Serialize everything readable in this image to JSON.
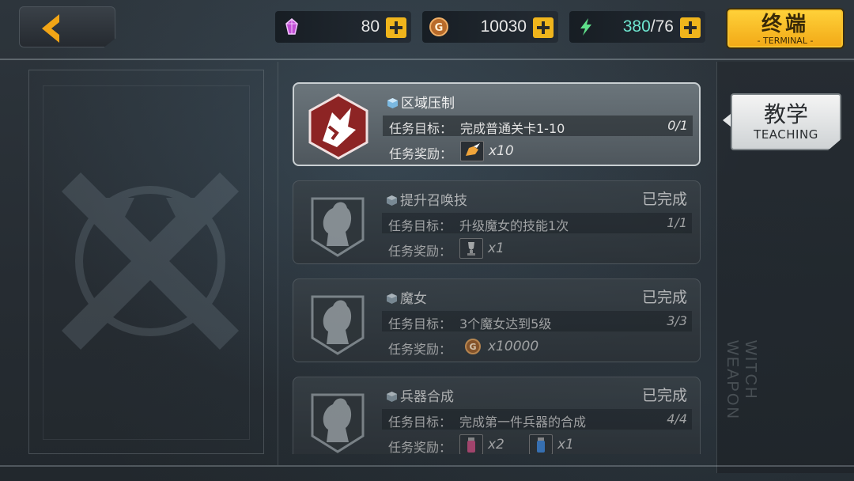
{
  "resources": {
    "gem": {
      "value": "80",
      "icon": "crystal-icon",
      "color": "#c24fd6"
    },
    "gold": {
      "value": "10030",
      "icon": "gold-coin-icon",
      "color": "#d98a3a"
    },
    "stamina": {
      "current": "380",
      "max": "/76",
      "icon": "lightning-icon",
      "color": "#6ee6d0"
    }
  },
  "terminal": {
    "label_cn": "终端",
    "label_en": "- TERMINAL -"
  },
  "teaching": {
    "label_cn": "教学",
    "label_en": "TEACHING"
  },
  "side_watermark": "WITCH WEAPON",
  "labels": {
    "goal": "任务目标：",
    "reward": "任务奖励："
  },
  "tasks": [
    {
      "title": "区域压制",
      "status": "",
      "goal": "完成普通关卡1-10",
      "progress": "0/1",
      "rewards": [
        {
          "icon": "wing-boots-icon",
          "qty": "x10"
        }
      ]
    },
    {
      "title": "提升召唤技",
      "status": "已完成",
      "goal": "升级魔女的技能1次",
      "progress": "1/1",
      "rewards": [
        {
          "icon": "trophy-icon",
          "qty": "x1"
        }
      ]
    },
    {
      "title": "魔女",
      "status": "已完成",
      "goal": "3个魔女达到5级",
      "progress": "3/3",
      "rewards": [
        {
          "icon": "gold-coin-icon",
          "qty": "x10000"
        }
      ]
    },
    {
      "title": "兵器合成",
      "status": "已完成",
      "goal": "完成第一件兵器的合成",
      "progress": "4/4",
      "rewards": [
        {
          "icon": "exp-potion-red-icon",
          "qty": "x2"
        },
        {
          "icon": "exp-potion-blue-icon",
          "qty": "x1"
        }
      ]
    }
  ]
}
